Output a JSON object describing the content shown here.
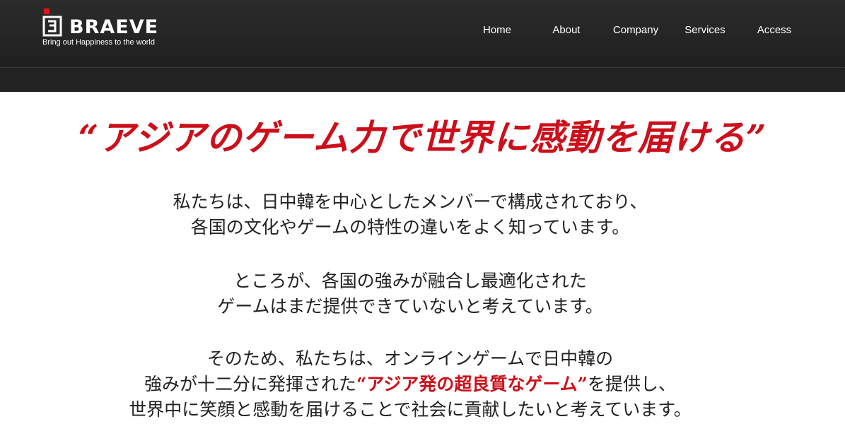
{
  "header": {
    "logo": {
      "name": "BRAEVE",
      "tagline": "Bring out Happiness to the world"
    },
    "nav": [
      {
        "label": "Home"
      },
      {
        "label": "About"
      },
      {
        "label": "Company"
      },
      {
        "label": "Services"
      },
      {
        "label": "Access"
      }
    ]
  },
  "main": {
    "headline": "“アジアのゲーム力で世界に感動を届ける”",
    "paragraphs": {
      "p1": {
        "line1": "私たちは、日中韓を中心としたメンバーで構成されており、",
        "line2": "各国の文化やゲームの特性の違いをよく知っています。"
      },
      "p2": {
        "line1": "ところが、各国の強みが融合し最適化された",
        "line2": "ゲームはまだ提供できていないと考えています。"
      },
      "p3": {
        "line1": "そのため、私たちは、オンラインゲームで日中韓の",
        "line2_before": "強みが十二分に発揮された",
        "line2_highlight": "“アジア発の超良質なゲーム”",
        "line2_after": "を提供し、",
        "line3": "世界中に笑顔と感動を届けることで社会に貢献したいと考えています。"
      }
    }
  },
  "colors": {
    "accent": "#cc0f1a",
    "header_bg": "#262626",
    "text": "#222222"
  }
}
